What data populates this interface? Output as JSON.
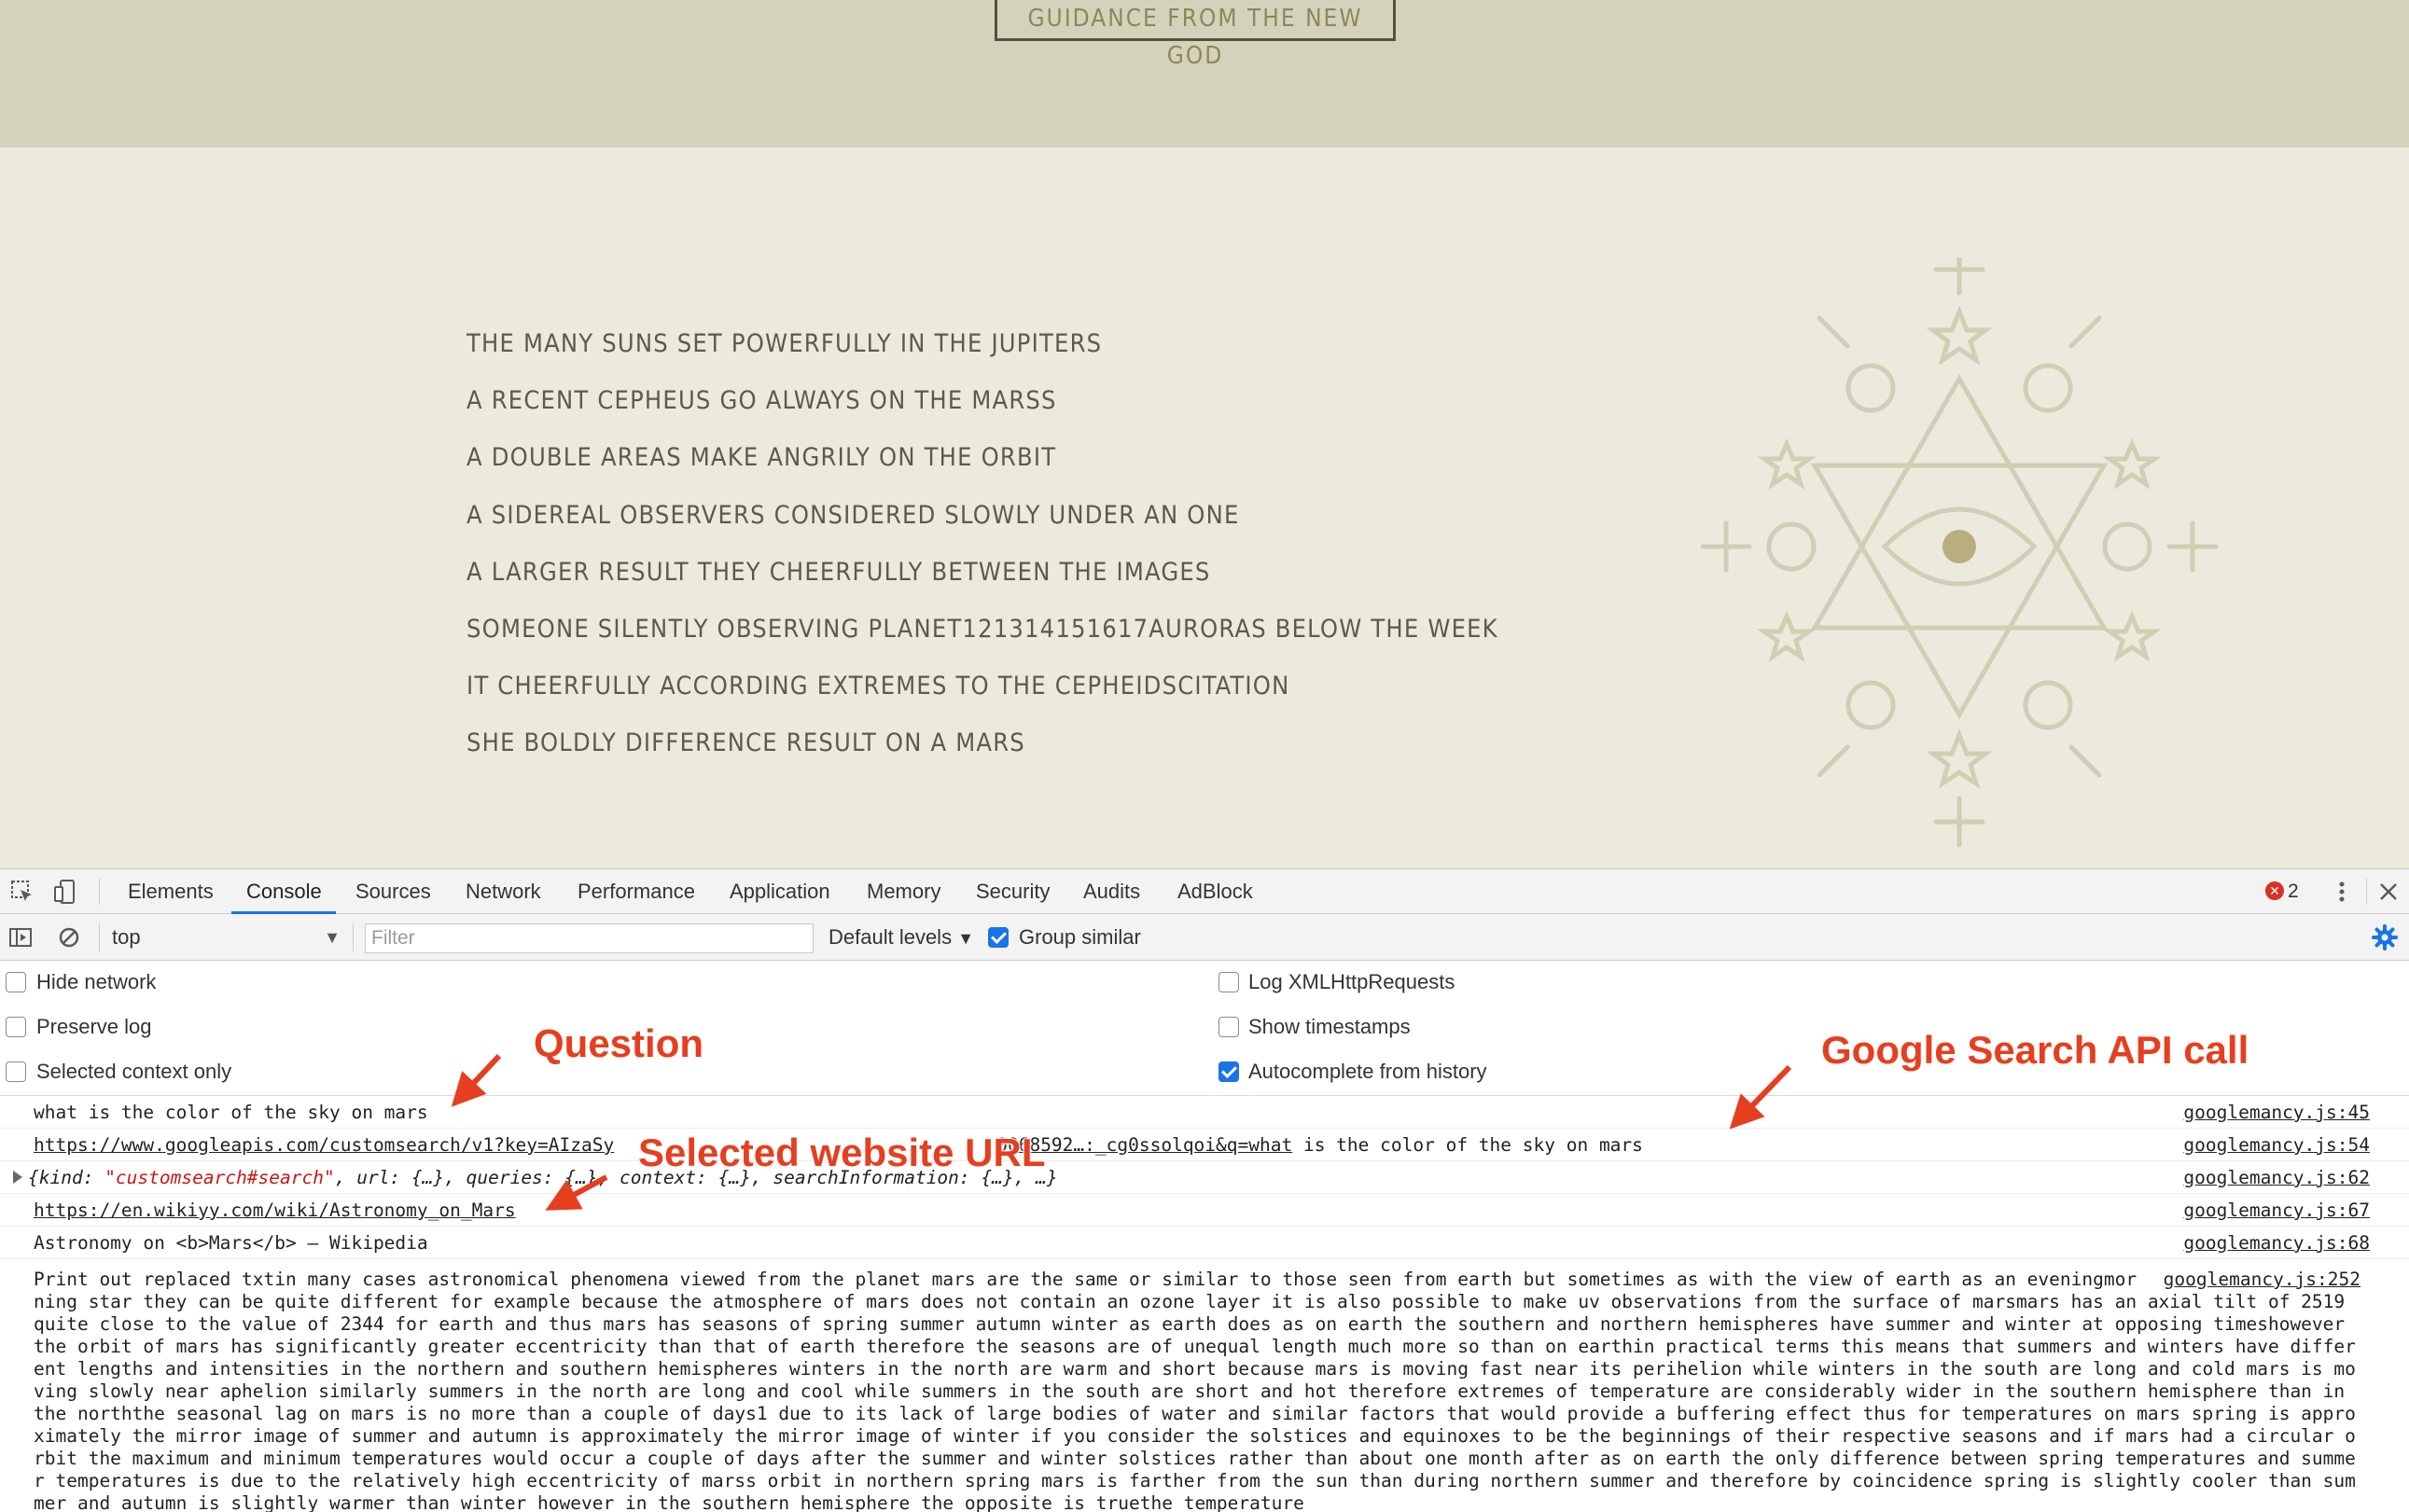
{
  "page": {
    "header_button": "GUIDANCE FROM THE NEW GOD",
    "prophecies": [
      "THE MANY SUNS SET POWERFULLY IN THE JUPITERS",
      "A RECENT CEPHEUS GO ALWAYS ON THE MARSS",
      "A DOUBLE AREAS MAKE ANGRILY ON THE ORBIT",
      "A SIDEREAL OBSERVERS CONSIDERED SLOWLY UNDER AN ONE",
      "A LARGER RESULT THEY CHEERFULLY BETWEEN THE IMAGES",
      "SOMEONE SILENTLY OBSERVING PLANET121314151617AURORAS BELOW THE WEEK",
      "IT CHEERFULLY ACCORDING EXTREMES TO THE CEPHEIDSCITATION",
      "SHE BOLDLY DIFFERENCE RESULT ON A MARS"
    ],
    "symbol_icon": "all-seeing-eye-hexagram-icon"
  },
  "devtools": {
    "tabs": [
      "Elements",
      "Console",
      "Sources",
      "Network",
      "Performance",
      "Application",
      "Memory",
      "Security",
      "Audits",
      "AdBlock"
    ],
    "active_tab": "Console",
    "error_count": "2",
    "context": "top",
    "filter_placeholder": "Filter",
    "levels": "Default levels",
    "group_similar": "Group similar",
    "settings_left": [
      "Hide network",
      "Preserve log",
      "Selected context only"
    ],
    "settings_right": [
      "Log XMLHttpRequests",
      "Show timestamps",
      "Autocomplete from history"
    ],
    "settings_right_checked": [
      false,
      false,
      true
    ]
  },
  "console": {
    "rows": [
      {
        "text": "what is the color of the sky on mars",
        "source": "googlemancy.js:45"
      },
      {
        "link": "https://www.googleapis.com/customsearch/v1?key=AIzaSy",
        "link_tail": "0068592…:_cg0ssolqoi&q=what",
        "text_after": " is the color of the sky on mars",
        "source": "googlemancy.js:54"
      },
      {
        "obj_open": "{kind: ",
        "obj_string": "\"customsearch#search\"",
        "obj_rest": ", url: {…}, queries: {…}, context: {…}, searchInformation: {…}, …}",
        "source": "googlemancy.js:62"
      },
      {
        "link": "https://en.wikiyy.com/wiki/Astronomy_on_Mars",
        "source": "googlemancy.js:67"
      },
      {
        "text": "Astronomy on <b>Mars</b> – Wikipedia",
        "source": "googlemancy.js:68"
      },
      {
        "text": "Print out replaced txtin many cases astronomical phenomena viewed from the planet mars are the same or similar to those seen from earth but sometimes as with the view of earth as an eveningmorning star they can be quite different for example because the atmosphere of mars does not contain an ozone layer it is also possible to make uv observations from the surface of marsmars has an axial tilt of 2519 quite close to the value of 2344 for earth and thus mars has seasons of spring summer autumn winter as earth does as on earth the southern and northern hemispheres have summer and winter at opposing timeshowever the orbit of mars has significantly greater eccentricity than that of earth therefore the seasons are of unequal length much more so than on earthin practical terms this means that summers and winters have different lengths and intensities in the northern and southern hemispheres winters in the north are warm and short because mars is moving fast near its perihelion while winters in the south are long and cold mars is moving slowly near aphelion similarly summers in the north are long and cool while summers in the south are short and hot therefore extremes of temperature are considerably wider in the southern hemisphere than in the norththe seasonal lag on mars is no more than a couple of days1 due to its lack of large bodies of water and similar factors that would provide a buffering effect thus for temperatures on mars spring is approximately the mirror image of summer and autumn is approximately the mirror image of winter if you consider the solstices and equinoxes to be the beginnings of their respective seasons and if mars had a circular orbit the maximum and minimum temperatures would occur a couple of days after the summer and winter solstices rather than about one month after as on earth the only difference between spring temperatures and summer temperatures is due to the relatively high eccentricity of marss orbit in northern spring mars is farther from the sun than during northern summer and therefore by coincidence spring is slightly cooler than summer and autumn is slightly warmer than winter however in the southern hemisphere the opposite is truethe temperature",
        "source": "googlemancy.js:252"
      }
    ]
  },
  "annotations": {
    "question": "Question",
    "api_call": "Google Search API call",
    "selected_url": "Selected website URL",
    "color": "#e53f1f"
  }
}
